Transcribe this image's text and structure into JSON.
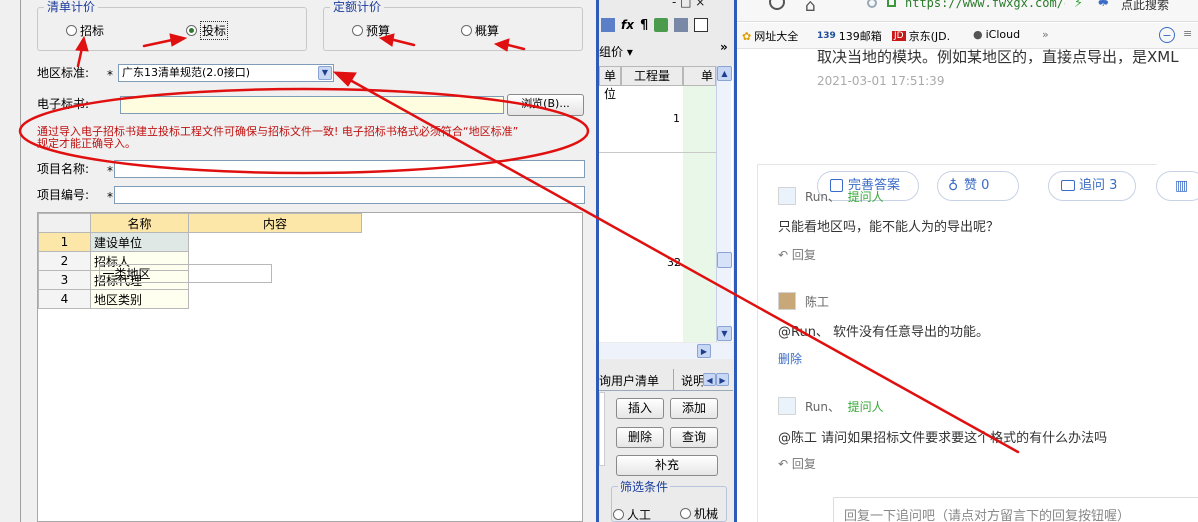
{
  "dialog": {
    "group_qingdan": {
      "title": "清单计价",
      "opt_zhaobiao": "招标",
      "opt_toubiao": "投标"
    },
    "group_dinge": {
      "title": "定额计价",
      "opt_yusuan": "预算",
      "opt_gaisuan": "概算"
    },
    "region_label": "地区标准:",
    "required_mark": "*",
    "region_value": "广东13清单规范(2.0接口)",
    "etender_label": "电子标书:",
    "browse_button": "浏览(B)...",
    "warning_line1": "通过导入电子招标书建立投标工程文件可确保与招标文件一致! 电子招标书格式必须符合“地区标准”",
    "warning_line2": "规定才能正确导入。",
    "project_name_label": "项目名称:",
    "project_code_label": "项目编号:",
    "table": {
      "headers": [
        "名称",
        "内容"
      ],
      "rows": [
        {
          "idx": "1",
          "name": "建设单位",
          "content": ""
        },
        {
          "idx": "2",
          "name": "招标人",
          "content": ""
        },
        {
          "idx": "3",
          "name": "招标代理",
          "content": ""
        },
        {
          "idx": "4",
          "name": "地区类别",
          "content": "一类地区"
        }
      ]
    }
  },
  "mid": {
    "top_controls": "- □ ×",
    "group_price": "组价 ▾",
    "more": "»",
    "col_unit": "单位",
    "col_qty": "工程量",
    "col_extra": "单",
    "val1": "1",
    "val2": "32",
    "tab_query": "询用户清单",
    "tab_desc": "说明",
    "btn_insert": "插入",
    "btn_add": "添加",
    "btn_delete": "删除",
    "btn_query": "查询",
    "btn_supplement": "补充",
    "filter_title": "筛选条件",
    "filter_labor": "人工",
    "filter_machine": "机械"
  },
  "browser": {
    "url": "https://www.fwxgx.com/q",
    "click_search": "点此搜索",
    "bookmarks": [
      "网址大全",
      "139邮箱",
      "京东(JD.",
      "iCloud"
    ],
    "answer_text": "取决当地的模块。例如某地区的，直接点导出，是XML",
    "answer_time": "2021-03-01 17:51:39",
    "btn_improve": "完善答案",
    "btn_like": "赞 0",
    "btn_followup": "追问 3",
    "comments": [
      {
        "user": "Run、",
        "tag": "提问人",
        "text": "只能看地区吗，能不能人为的导出呢？",
        "action": "回复"
      },
      {
        "user": "陈工",
        "tag": "",
        "text": "@Run、 软件没有任意导出的功能。",
        "action": "删除"
      },
      {
        "user": "Run、",
        "tag": "提问人",
        "text": "@陈工 请问如果招标文件要求要这个格式的有什么办法吗",
        "action": "回复"
      }
    ],
    "reply_placeholder": "回复一下追问吧（请点对方留言下的回复按钮喔）"
  },
  "colors": {
    "annotation_red": "#e01010",
    "link_blue": "#3a6bc6",
    "asker_green": "#38a838",
    "window_blue": "#2e5bb8"
  }
}
